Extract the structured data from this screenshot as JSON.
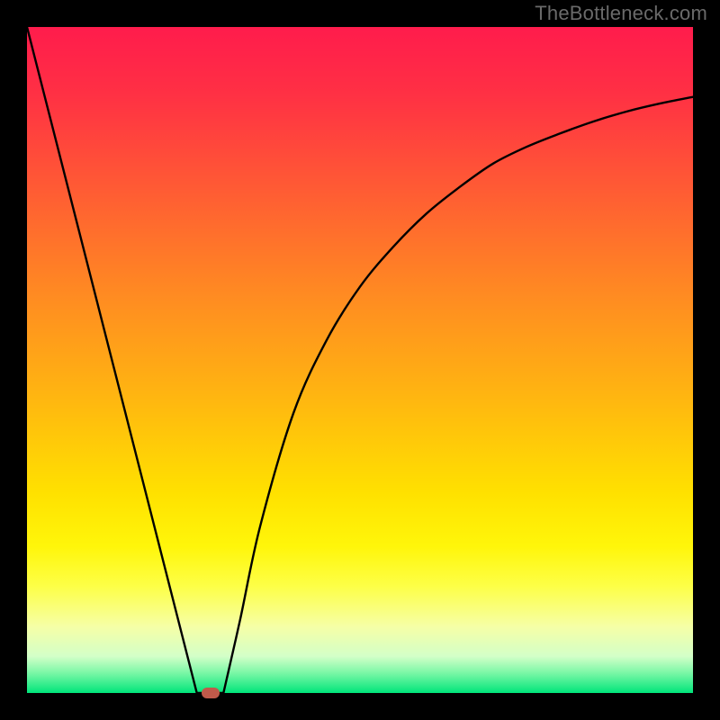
{
  "watermark": "TheBottleneck.com",
  "gradient": {
    "stops": [
      {
        "offset": 0.0,
        "color": "#ff1c4c"
      },
      {
        "offset": 0.1,
        "color": "#ff3044"
      },
      {
        "offset": 0.25,
        "color": "#ff5d33"
      },
      {
        "offset": 0.4,
        "color": "#ff8a22"
      },
      {
        "offset": 0.55,
        "color": "#ffb411"
      },
      {
        "offset": 0.7,
        "color": "#ffe100"
      },
      {
        "offset": 0.78,
        "color": "#fff60a"
      },
      {
        "offset": 0.84,
        "color": "#fdff47"
      },
      {
        "offset": 0.9,
        "color": "#f6ffa6"
      },
      {
        "offset": 0.945,
        "color": "#d3ffc8"
      },
      {
        "offset": 0.97,
        "color": "#7af7a6"
      },
      {
        "offset": 1.0,
        "color": "#00e57a"
      }
    ]
  },
  "chart_data": {
    "type": "line",
    "title": "",
    "xlabel": "",
    "ylabel": "",
    "xlim": [
      0,
      1
    ],
    "ylim": [
      0,
      100
    ],
    "legend": false,
    "grid": false,
    "series": [
      {
        "name": "left-segment",
        "x": [
          0.0,
          0.255
        ],
        "values": [
          100,
          0
        ]
      },
      {
        "name": "right-segment",
        "x": [
          0.295,
          0.32,
          0.35,
          0.4,
          0.45,
          0.5,
          0.55,
          0.6,
          0.65,
          0.7,
          0.75,
          0.8,
          0.85,
          0.9,
          0.95,
          1.0
        ],
        "values": [
          0,
          11,
          25,
          42,
          53,
          61,
          67,
          72,
          76,
          79.5,
          82,
          84,
          85.8,
          87.3,
          88.5,
          89.5
        ]
      }
    ],
    "annotations": [
      {
        "name": "minimum-marker",
        "x": 0.275,
        "y": 0,
        "color": "#c05a4a"
      }
    ]
  }
}
